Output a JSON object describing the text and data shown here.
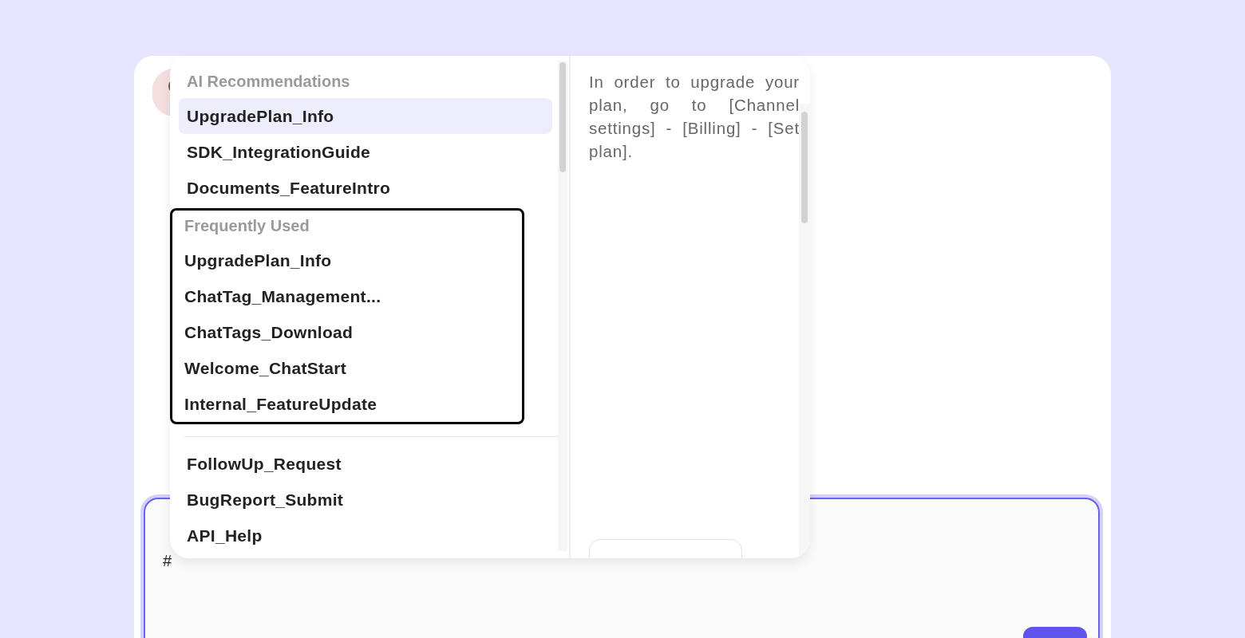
{
  "template_menu": {
    "sections": [
      {
        "heading": "AI Recommendations",
        "outlined": false,
        "items": [
          {
            "label": "UpgradePlan_Info",
            "selected": true
          },
          {
            "label": "SDK_IntegrationGuide",
            "selected": false
          },
          {
            "label": "Documents_FeatureIntro",
            "selected": false
          }
        ]
      },
      {
        "heading": "Frequently Used",
        "outlined": true,
        "items": [
          {
            "label": "UpgradePlan_Info",
            "selected": false
          },
          {
            "label": "ChatTag_Management...",
            "selected": false
          },
          {
            "label": "ChatTags_Download",
            "selected": false
          },
          {
            "label": "Welcome_ChatStart",
            "selected": false
          },
          {
            "label": "Internal_FeatureUpdate",
            "selected": false
          }
        ]
      },
      {
        "outlined": false,
        "items": [
          {
            "label": "FollowUp_Request",
            "selected": false
          },
          {
            "label": "BugReport_Submit",
            "selected": false
          },
          {
            "label": "API_Help",
            "selected": false
          }
        ]
      }
    ],
    "preview": {
      "text": "In order to upgrade your plan, go to [Channel settings] - [Billing] - [Set plan]."
    }
  },
  "composer": {
    "value": "#"
  }
}
